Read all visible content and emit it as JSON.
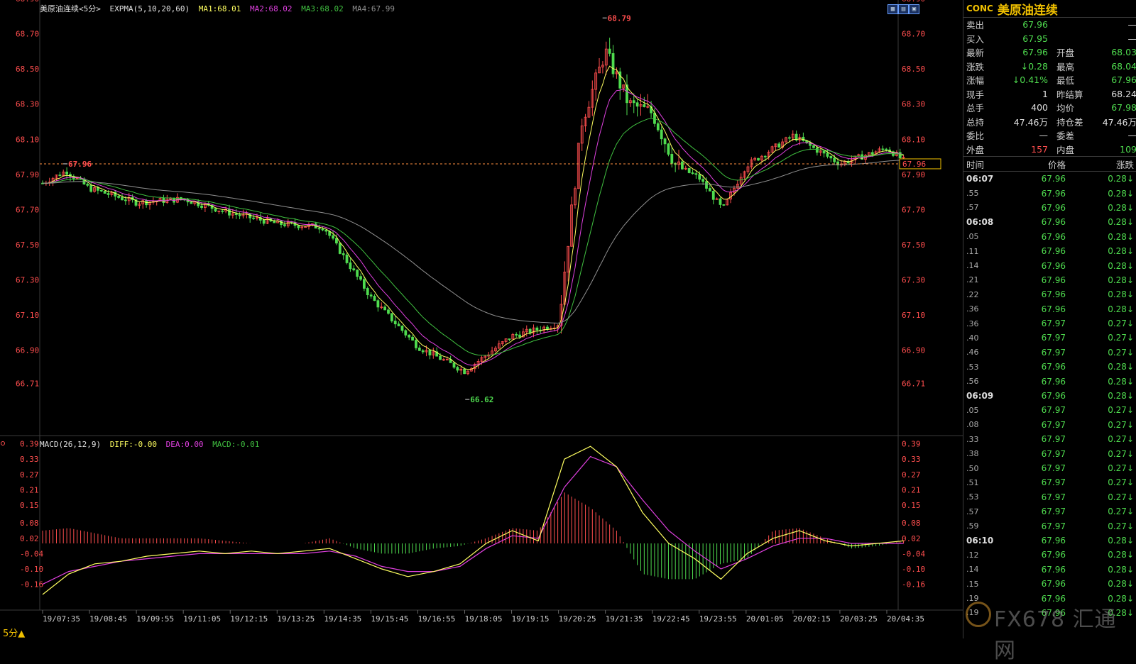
{
  "chart_header": {
    "title": "美原油连续",
    "period": "<5分>",
    "indicator": "EXPMA(5,10,20,60)",
    "ma1": "MA1:68.01",
    "ma2": "MA2:68.02",
    "ma3": "MA3:68.02",
    "ma4": "MA4:67.99"
  },
  "macd_header": {
    "label": "MACD(26,12,9)",
    "diff": "DIFF:-0.00",
    "dea": "DEA:0.00",
    "macd": "MACD:-0.01"
  },
  "colors": {
    "up": "#ff4e4e",
    "down": "#4fdc4f",
    "ma1": "#ffff60",
    "ma2": "#e040e0",
    "ma3": "#40c040",
    "ma4": "#909090",
    "axis_text": "#ff4e4e",
    "ref_line": "#ff9040",
    "highlight": "#f0c000"
  },
  "chart_data": [
    {
      "type": "candlestick",
      "ylim": [
        66.6,
        68.9
      ],
      "y_ticks": [
        "68.90",
        "68.70",
        "68.50",
        "68.30",
        "68.10",
        "67.90",
        "67.70",
        "67.50",
        "67.30",
        "67.10",
        "66.90",
        "66.71"
      ],
      "x_ticks": [
        "19/07:35",
        "19/08:45",
        "19/09:55",
        "19/11:05",
        "19/12:15",
        "19/13:25",
        "19/14:35",
        "19/15:45",
        "19/16:55",
        "19/18:05",
        "19/19:15",
        "19/20:25",
        "19/21:35",
        "19/22:45",
        "19/23:55",
        "20/01:05",
        "20/02:15",
        "20/03:25",
        "20/04:35"
      ],
      "annotations": [
        {
          "text": "67.96",
          "x": "19/08:10",
          "y": 67.96
        },
        {
          "text": "68.79",
          "x": "19/21:35",
          "y": 68.79
        },
        {
          "text": "66.62",
          "x": "19/18:10",
          "y": 66.62
        }
      ],
      "reference_line": {
        "value": 67.96,
        "label": "67.96"
      },
      "close_path": [
        {
          "x": "19/07:35",
          "y": 67.85
        },
        {
          "x": "19/08:10",
          "y": 67.92
        },
        {
          "x": "19/08:45",
          "y": 67.82
        },
        {
          "x": "19/09:55",
          "y": 67.74
        },
        {
          "x": "19/11:05",
          "y": 67.76
        },
        {
          "x": "19/12:15",
          "y": 67.68
        },
        {
          "x": "19/13:25",
          "y": 67.62
        },
        {
          "x": "19/14:35",
          "y": 67.6
        },
        {
          "x": "19/15:45",
          "y": 67.2
        },
        {
          "x": "19/16:55",
          "y": 66.92
        },
        {
          "x": "19/18:05",
          "y": 66.78
        },
        {
          "x": "19/19:15",
          "y": 66.98
        },
        {
          "x": "19/20:25",
          "y": 67.05
        },
        {
          "x": "19/21:00",
          "y": 68.2
        },
        {
          "x": "19/21:35",
          "y": 68.6
        },
        {
          "x": "19/22:10",
          "y": 68.3
        },
        {
          "x": "19/22:45",
          "y": 68.25
        },
        {
          "x": "19/23:20",
          "y": 67.95
        },
        {
          "x": "19/23:55",
          "y": 67.88
        },
        {
          "x": "20/00:30",
          "y": 67.7
        },
        {
          "x": "20/01:05",
          "y": 67.95
        },
        {
          "x": "20/02:15",
          "y": 68.12
        },
        {
          "x": "20/03:25",
          "y": 67.96
        },
        {
          "x": "20/04:35",
          "y": 68.05
        },
        {
          "x": "20/05:00",
          "y": 67.98
        }
      ]
    },
    {
      "type": "macd",
      "ylim": [
        -0.2,
        0.4
      ],
      "y_ticks": [
        "0.39",
        "0.33",
        "0.27",
        "0.21",
        "0.15",
        "0.08",
        "0.02",
        "-0.04",
        "-0.10",
        "-0.16"
      ],
      "diff_series": [
        -0.2,
        -0.12,
        -0.08,
        -0.07,
        -0.05,
        -0.04,
        -0.03,
        -0.04,
        -0.03,
        -0.04,
        -0.03,
        -0.02,
        -0.06,
        -0.1,
        -0.13,
        -0.11,
        -0.08,
        0.0,
        0.05,
        0.01,
        0.33,
        0.38,
        0.3,
        0.12,
        0.0,
        -0.06,
        -0.14,
        -0.04,
        0.02,
        0.05,
        0.01,
        -0.01,
        0.0,
        0.01
      ],
      "dea_series": [
        -0.16,
        -0.11,
        -0.09,
        -0.07,
        -0.06,
        -0.05,
        -0.04,
        -0.04,
        -0.04,
        -0.04,
        -0.04,
        -0.03,
        -0.05,
        -0.09,
        -0.11,
        -0.11,
        -0.09,
        -0.02,
        0.03,
        0.02,
        0.22,
        0.34,
        0.3,
        0.17,
        0.05,
        -0.03,
        -0.1,
        -0.06,
        -0.01,
        0.02,
        0.02,
        0.0,
        0.0,
        0.0
      ],
      "macd_series": [
        0.05,
        0.06,
        0.04,
        0.02,
        0.02,
        0.02,
        0.02,
        0.01,
        0.0,
        0.0,
        0.0,
        0.02,
        -0.02,
        -0.04,
        -0.04,
        -0.02,
        -0.01,
        0.02,
        0.06,
        0.05,
        0.2,
        0.14,
        0.05,
        -0.12,
        -0.14,
        -0.14,
        -0.08,
        -0.06,
        0.05,
        0.06,
        0.02,
        -0.02,
        -0.01,
        0.01
      ]
    }
  ],
  "period_label": "5分▲",
  "sidebar": {
    "code": "CONC",
    "name": "美原油连续",
    "quotes": [
      {
        "l1": "卖出",
        "v1": "67.96",
        "c1": "green",
        "l2": "",
        "v2": "—",
        "c2": "white"
      },
      {
        "l1": "买入",
        "v1": "67.95",
        "c1": "green",
        "l2": "",
        "v2": "—",
        "c2": "white"
      },
      {
        "l1": "最新",
        "v1": "67.96",
        "c1": "green",
        "l2": "开盘",
        "v2": "68.03",
        "c2": "green"
      },
      {
        "l1": "涨跌",
        "v1": "↓0.28",
        "c1": "green",
        "l2": "最高",
        "v2": "68.04",
        "c2": "green"
      },
      {
        "l1": "涨幅",
        "v1": "↓0.41%",
        "c1": "green",
        "l2": "最低",
        "v2": "67.96",
        "c2": "green"
      },
      {
        "l1": "现手",
        "v1": "1",
        "c1": "white",
        "l2": "昨结算",
        "v2": "68.24",
        "c2": "white"
      },
      {
        "l1": "总手",
        "v1": "400",
        "c1": "white",
        "l2": "均价",
        "v2": "67.98",
        "c2": "green"
      },
      {
        "l1": "总持",
        "v1": "47.46万",
        "c1": "white",
        "l2": "持仓差",
        "v2": "47.46万",
        "c2": "white"
      },
      {
        "l1": "委比",
        "v1": "—",
        "c1": "white",
        "l2": "委差",
        "v2": "—",
        "c2": "white"
      },
      {
        "l1": "外盘",
        "v1": "157",
        "c1": "red",
        "l2": "内盘",
        "v2": "109",
        "c2": "green"
      }
    ],
    "tick_header": {
      "time": "时间",
      "price": "价格",
      "chg": "涨跌"
    },
    "ticks": [
      {
        "t": "06:07",
        "bold": true,
        "p": "67.96",
        "c": "0.28↓"
      },
      {
        "t": ".55",
        "bold": false,
        "p": "67.96",
        "c": "0.28↓"
      },
      {
        "t": ".57",
        "bold": false,
        "p": "67.96",
        "c": "0.28↓"
      },
      {
        "t": "06:08",
        "bold": true,
        "p": "67.96",
        "c": "0.28↓"
      },
      {
        "t": ".05",
        "bold": false,
        "p": "67.96",
        "c": "0.28↓"
      },
      {
        "t": ".11",
        "bold": false,
        "p": "67.96",
        "c": "0.28↓"
      },
      {
        "t": ".14",
        "bold": false,
        "p": "67.96",
        "c": "0.28↓"
      },
      {
        "t": ".21",
        "bold": false,
        "p": "67.96",
        "c": "0.28↓"
      },
      {
        "t": ".22",
        "bold": false,
        "p": "67.96",
        "c": "0.28↓"
      },
      {
        "t": ".36",
        "bold": false,
        "p": "67.96",
        "c": "0.28↓"
      },
      {
        "t": ".36",
        "bold": false,
        "p": "67.97",
        "c": "0.27↓"
      },
      {
        "t": ".40",
        "bold": false,
        "p": "67.97",
        "c": "0.27↓"
      },
      {
        "t": ".46",
        "bold": false,
        "p": "67.97",
        "c": "0.27↓"
      },
      {
        "t": ".53",
        "bold": false,
        "p": "67.96",
        "c": "0.28↓"
      },
      {
        "t": ".56",
        "bold": false,
        "p": "67.96",
        "c": "0.28↓"
      },
      {
        "t": "06:09",
        "bold": true,
        "p": "67.96",
        "c": "0.28↓"
      },
      {
        "t": ".05",
        "bold": false,
        "p": "67.97",
        "c": "0.27↓"
      },
      {
        "t": ".08",
        "bold": false,
        "p": "67.97",
        "c": "0.27↓"
      },
      {
        "t": ".33",
        "bold": false,
        "p": "67.97",
        "c": "0.27↓"
      },
      {
        "t": ".38",
        "bold": false,
        "p": "67.97",
        "c": "0.27↓"
      },
      {
        "t": ".50",
        "bold": false,
        "p": "67.97",
        "c": "0.27↓"
      },
      {
        "t": ".51",
        "bold": false,
        "p": "67.97",
        "c": "0.27↓"
      },
      {
        "t": ".53",
        "bold": false,
        "p": "67.97",
        "c": "0.27↓"
      },
      {
        "t": ".57",
        "bold": false,
        "p": "67.97",
        "c": "0.27↓"
      },
      {
        "t": ".59",
        "bold": false,
        "p": "67.97",
        "c": "0.27↓"
      },
      {
        "t": "06:10",
        "bold": true,
        "p": "67.96",
        "c": "0.28↓"
      },
      {
        "t": ".12",
        "bold": false,
        "p": "67.96",
        "c": "0.28↓"
      },
      {
        "t": ".14",
        "bold": false,
        "p": "67.96",
        "c": "0.28↓"
      },
      {
        "t": ".15",
        "bold": false,
        "p": "67.96",
        "c": "0.28↓"
      },
      {
        "t": ".19",
        "bold": false,
        "p": "67.96",
        "c": "0.28↓"
      },
      {
        "t": ".19",
        "bold": false,
        "p": "67.96",
        "c": "0.28↓"
      }
    ]
  },
  "watermark": "FX678 汇通网"
}
